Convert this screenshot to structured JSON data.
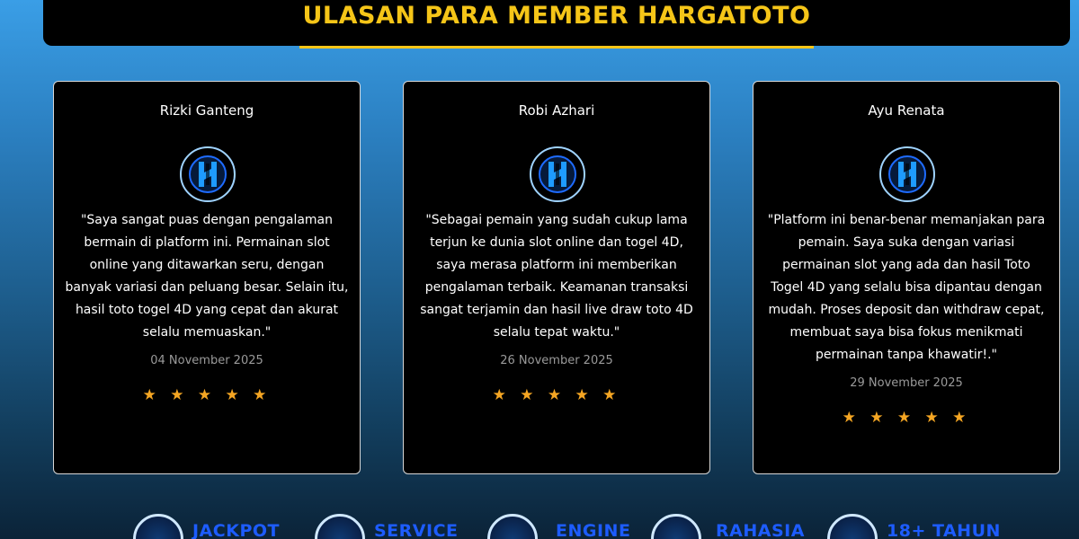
{
  "header": {
    "title": "ULASAN PARA MEMBER HARGATOTO"
  },
  "reviews": [
    {
      "name": "Rizki Ganteng",
      "text": "\"Saya sangat puas dengan pengalaman bermain di platform ini. Permainan slot online yang ditawarkan seru, dengan banyak variasi dan peluang besar. Selain itu, hasil toto togel 4D yang cepat dan akurat selalu memuaskan.\"",
      "date": "04 November 2025",
      "stars": "★ ★ ★ ★ ★"
    },
    {
      "name": "Robi Azhari",
      "text": "\"Sebagai pemain yang sudah cukup lama terjun ke dunia slot online dan togel 4D, saya merasa platform ini memberikan pengalaman terbaik. Keamanan transaksi sangat terjamin dan hasil live draw toto 4D selalu tepat waktu.\"",
      "date": "26 November 2025",
      "stars": "★ ★ ★ ★ ★"
    },
    {
      "name": "Ayu Renata",
      "text": "\"Platform ini benar-benar memanjakan para pemain. Saya suka dengan variasi permainan slot yang ada dan hasil Toto Togel 4D yang selalu bisa dipantau dengan mudah. Proses deposit dan withdraw cepat, membuat saya bisa fokus menikmati permainan tanpa khawatir!.\"",
      "date": "29 November 2025",
      "stars": "★ ★ ★ ★ ★"
    }
  ],
  "badges": [
    {
      "label": "JACKPOT",
      "icon": "jackpot-icon"
    },
    {
      "label": "SERVICE",
      "icon": "service-icon"
    },
    {
      "label": "ENGINE",
      "icon": "engine-icon"
    },
    {
      "label": "RAHASIA",
      "icon": "lock-icon"
    },
    {
      "label": "18+ TAHUN",
      "icon": "age-18-icon"
    }
  ],
  "colors": {
    "accent": "#f5c518",
    "star": "#f5a623",
    "badge_text": "#1d5cff"
  }
}
